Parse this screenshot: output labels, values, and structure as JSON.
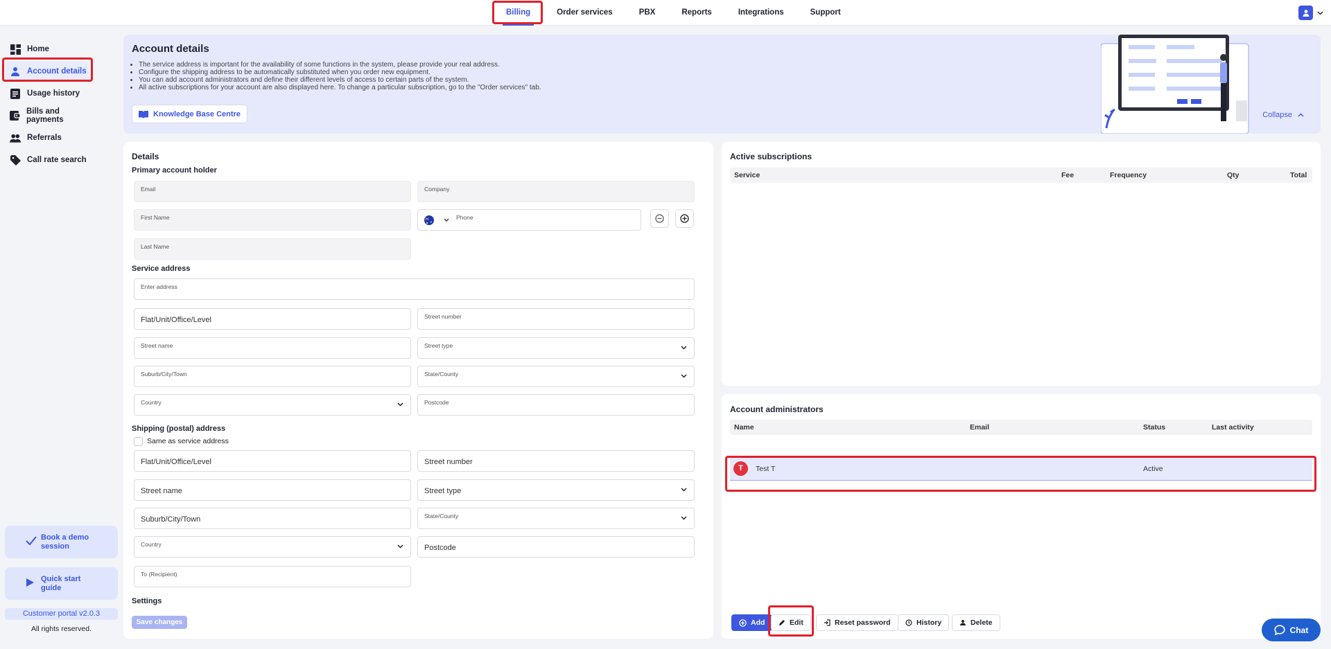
{
  "topnav": {
    "tabs": [
      "Billing",
      "Order services",
      "PBX",
      "Reports",
      "Integrations",
      "Support"
    ],
    "active": "Billing"
  },
  "sidebar": {
    "items": [
      {
        "label": "Home",
        "icon": "dashboard-icon"
      },
      {
        "label": "Account details",
        "icon": "person-icon"
      },
      {
        "label": "Usage history",
        "icon": "document-icon"
      },
      {
        "label": "Bills and payments",
        "icon": "wallet-icon"
      },
      {
        "label": "Referrals",
        "icon": "people-icon"
      },
      {
        "label": "Call rate search",
        "icon": "tag-icon"
      }
    ],
    "active": "Account details",
    "promo_demo": "Book a demo session",
    "promo_guide": "Quick start guide",
    "version": "Customer portal v2.0.3",
    "rights": "All rights reserved."
  },
  "banner": {
    "title": "Account details",
    "bullets": [
      "The service address is important for the availability of some functions in the system, please provide your real address.",
      "Configure the shipping address to be automatically substituted when you order new equipment.",
      "You can add account administrators and define their different levels of access to certain parts of the system.",
      "All active subscriptions for your account are also displayed here. To change a particular subscription, go to the \"Order services\" tab."
    ],
    "kb_button": "Knowledge Base Centre",
    "collapse": "Collapse"
  },
  "details": {
    "title": "Details",
    "primary_holder": "Primary account holder",
    "email": "Email",
    "company": "Company",
    "first_name": "First Name",
    "phone": "Phone",
    "last_name": "Last Name",
    "service_address": "Service address",
    "enter_address": "Enter address",
    "flat": "Flat/Unit/Office/Level",
    "street_number": "Street number",
    "street_name": "Street name",
    "street_type": "Street type",
    "suburb": "Suburb/City/Town",
    "state": "State/County",
    "country": "Country",
    "postcode": "Postcode",
    "shipping_address": "Shipping (postal) address",
    "same_as_service": "Same as service address",
    "recipient": "To (Recipient)",
    "settings": "Settings",
    "save": "Save changes"
  },
  "subscriptions": {
    "title": "Active subscriptions",
    "columns": [
      "Service",
      "Fee",
      "Frequency",
      "Qty",
      "Total"
    ]
  },
  "admins": {
    "title": "Account administrators",
    "columns": [
      "Name",
      "Email",
      "Status",
      "Last activity"
    ],
    "rows": [
      {
        "initial": "T",
        "name": "Test T",
        "email": "",
        "status": "Active",
        "last_activity": ""
      }
    ],
    "buttons": {
      "add": "Add",
      "edit": "Edit",
      "reset": "Reset password",
      "history": "History",
      "delete": "Delete"
    }
  },
  "chat": "Chat",
  "colors": {
    "accent": "#3d57e0",
    "highlight": "#e0212b",
    "avatar": "#e0323d"
  }
}
